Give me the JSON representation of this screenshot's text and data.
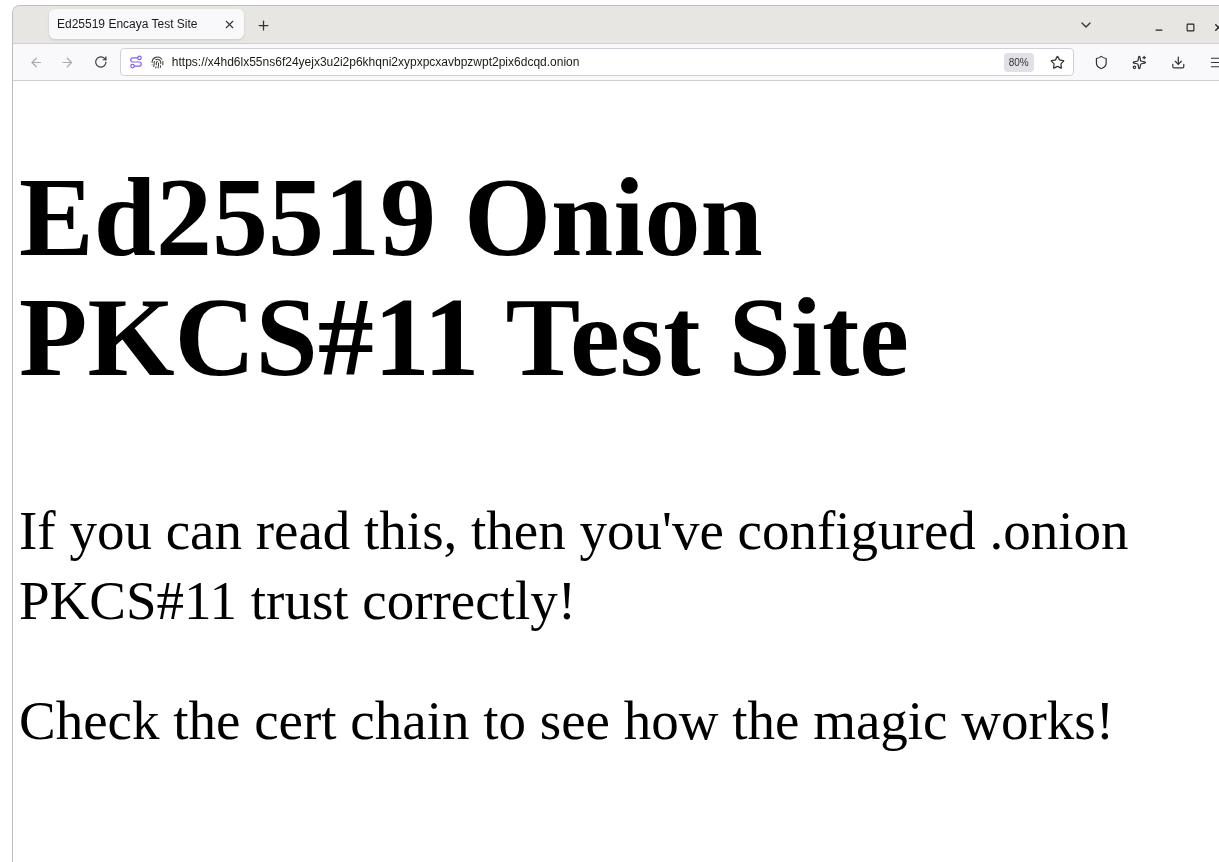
{
  "tabs": [
    {
      "title": "Ed25519 Encaya Test Site",
      "selected": true
    }
  ],
  "address_bar": {
    "url": "https://x4hd6lx55ns6f24yejx3u2i2p6khqni2xypxpcxavbpzwpt2pix6dcqd.onion",
    "zoom": "80%"
  },
  "page": {
    "heading": "Ed25519 Onion PKCS#11 Test Site",
    "paragraphs": [
      "If you can read this, then you've configured .onion PKCS#11 trust correctly!",
      "Check the cert chain to see how the magic works!"
    ]
  }
}
